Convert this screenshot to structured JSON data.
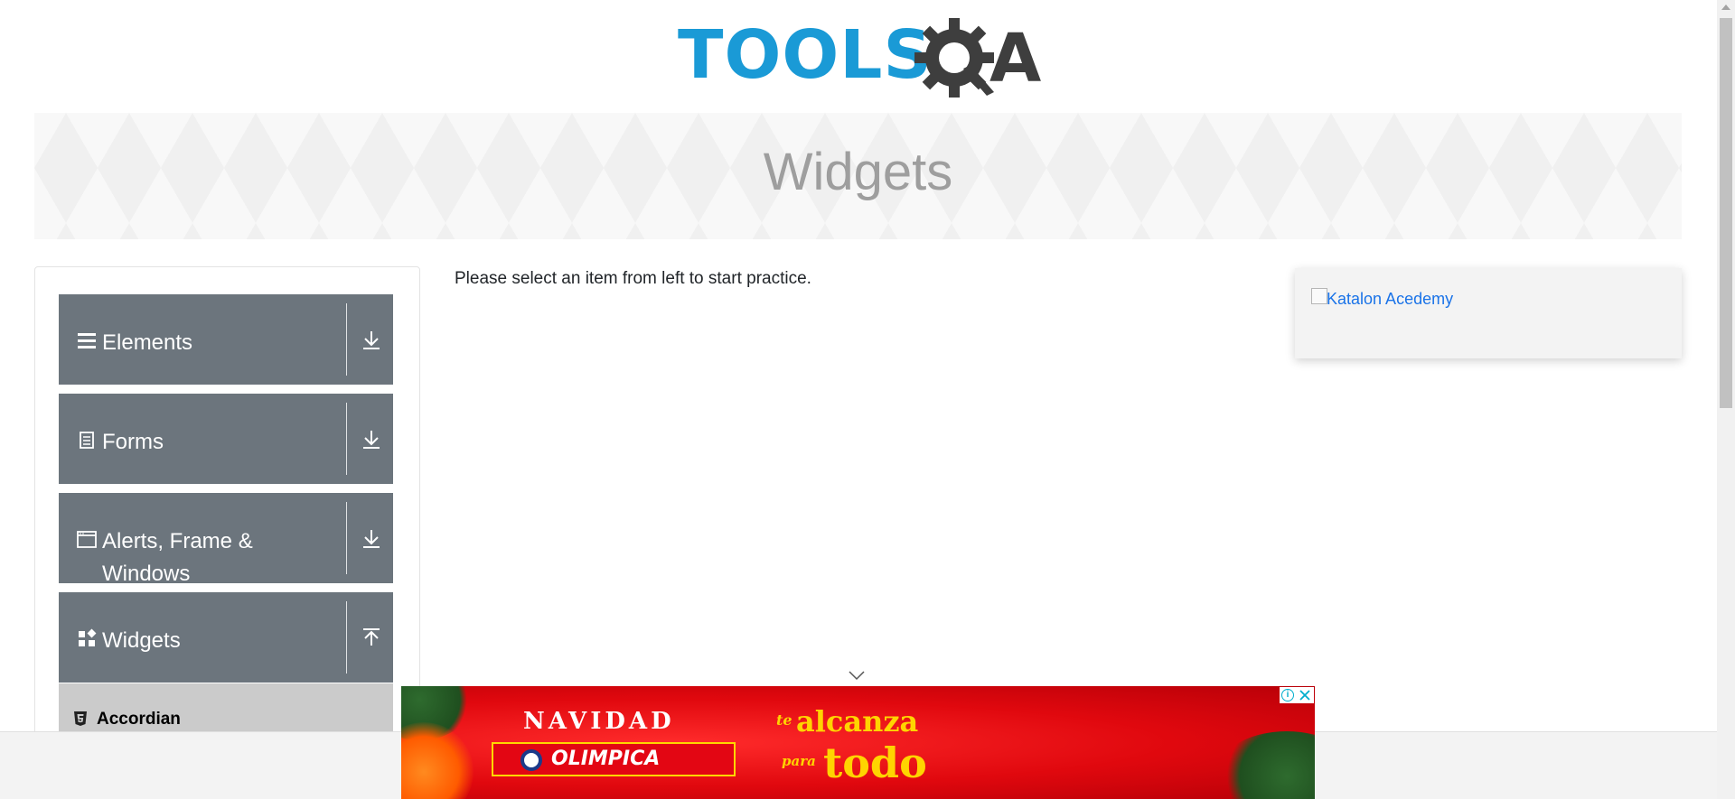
{
  "logo": {
    "text": "TOOLS",
    "suffix": "A",
    "gear_icon": "gear-q-icon"
  },
  "banner": {
    "title": "Widgets"
  },
  "sidebar": {
    "groups": [
      {
        "label": "Elements",
        "icon": "hamburger-icon",
        "arrow": "download-arrow-icon",
        "expanded": false
      },
      {
        "label": "Forms",
        "icon": "document-icon",
        "arrow": "download-arrow-icon",
        "expanded": false
      },
      {
        "label": "Alerts, Frame & Windows",
        "icon": "window-icon",
        "arrow": "download-arrow-icon",
        "expanded": false
      },
      {
        "label": "Widgets",
        "icon": "widgets-icon",
        "arrow": "upload-arrow-icon",
        "expanded": true
      }
    ],
    "sub_items": [
      {
        "label": "Accordian",
        "icon": "html5-icon"
      }
    ]
  },
  "main": {
    "message": "Please select an item from left to start practice."
  },
  "right_ad": {
    "alt_text": "Katalon Acedemy"
  },
  "bottom_ad": {
    "headline": "NAVIDAD",
    "brand": "OLIMPICA",
    "slogan_1": "te",
    "slogan_2": "alcanza",
    "slogan_3": "para",
    "slogan_4": "todo"
  },
  "colors": {
    "logo_blue": "#1a9ad6",
    "logo_dark": "#3e3e3e",
    "sidebar_group": "#6c757d",
    "sidebar_sub": "#cbcbcb",
    "ad_red": "#e0080e",
    "ad_gold": "#ffd400"
  }
}
